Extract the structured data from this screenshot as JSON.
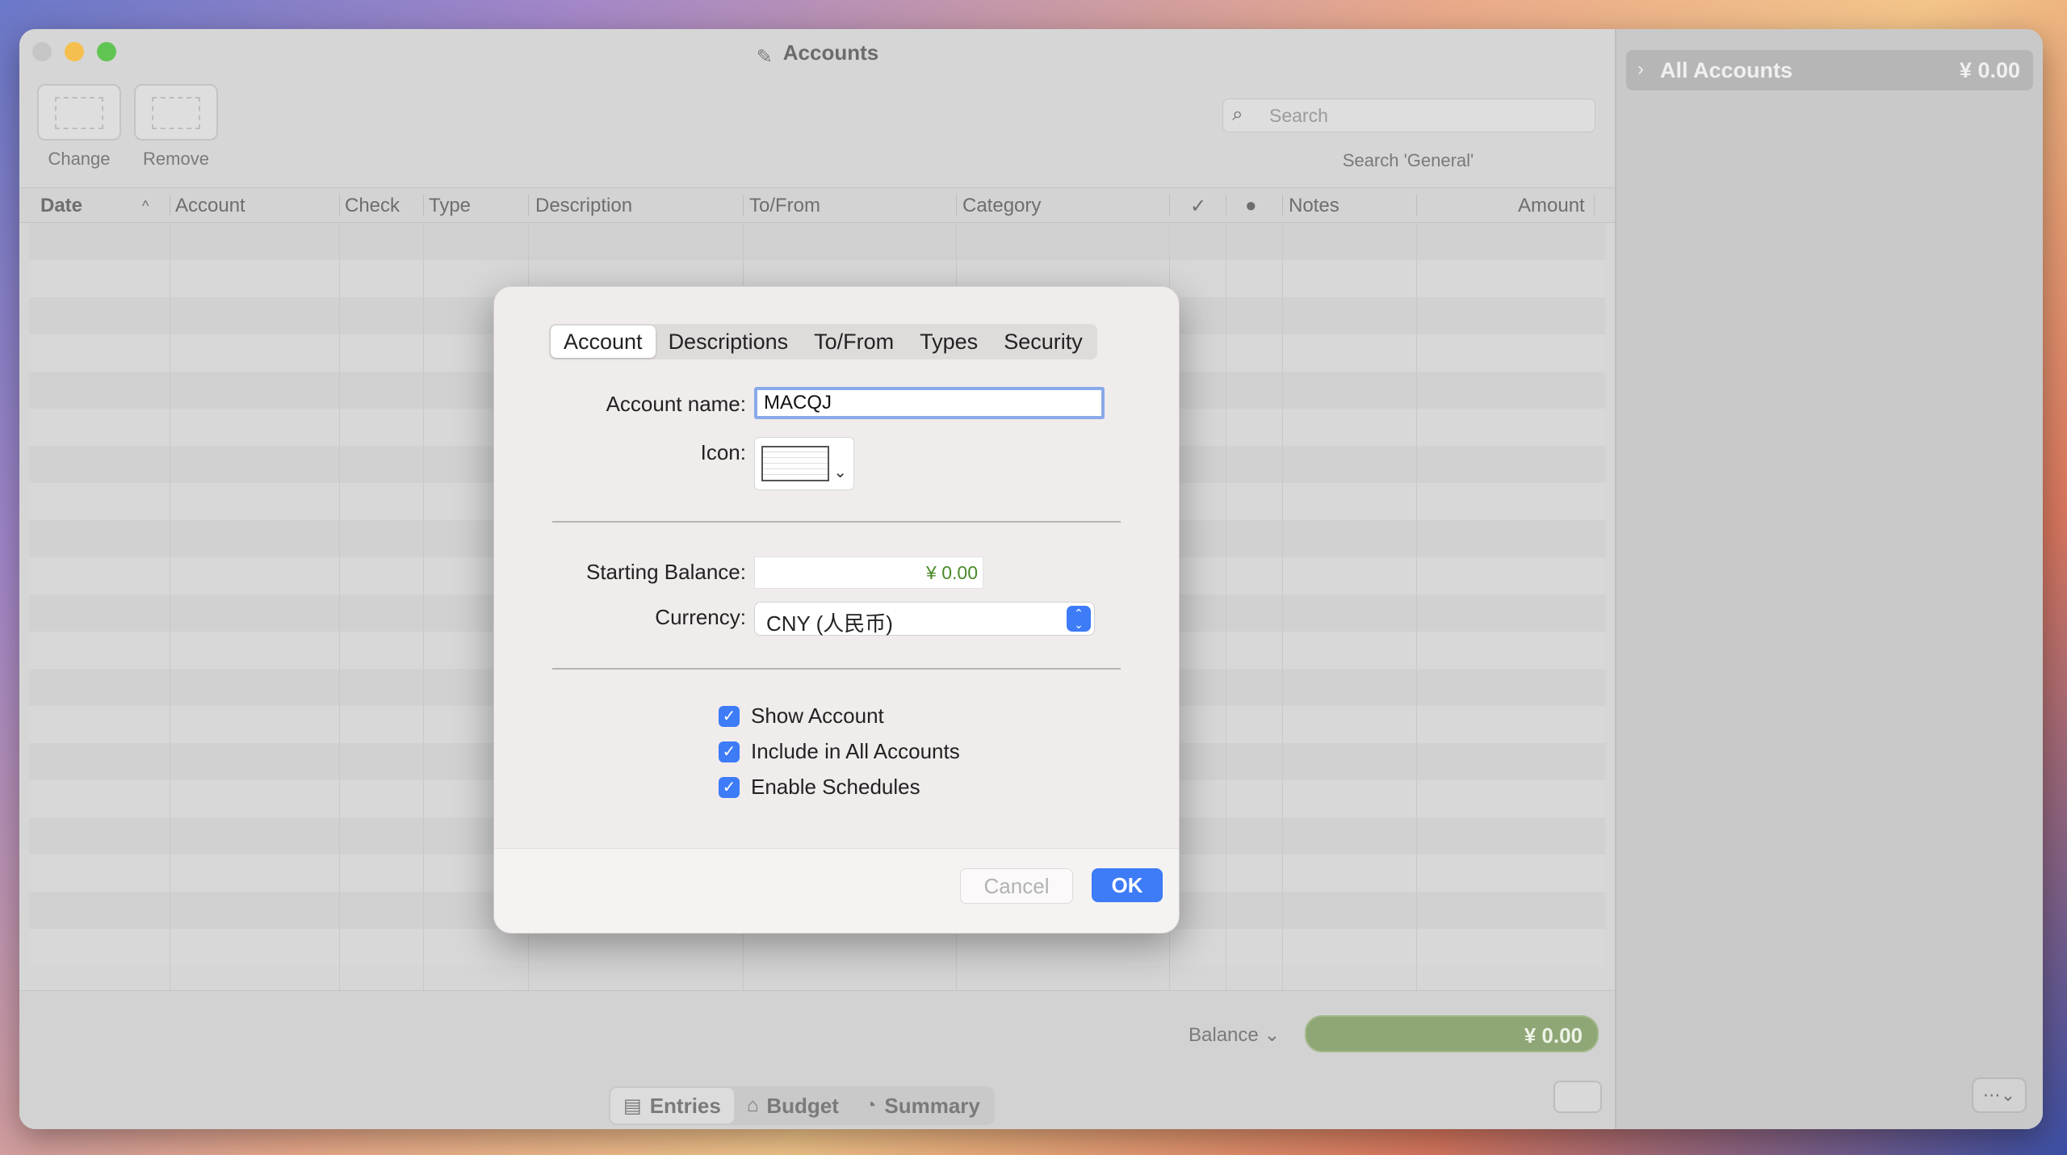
{
  "window": {
    "title": "Accounts"
  },
  "toolbar": {
    "change_label": "Change",
    "remove_label": "Remove"
  },
  "search": {
    "placeholder": "Search",
    "scope": "Search 'General'"
  },
  "table": {
    "columns": [
      "Date",
      "Account",
      "Check",
      "Type",
      "Description",
      "To/From",
      "Category",
      "✓",
      "",
      "Notes",
      "Amount"
    ]
  },
  "footer": {
    "balance_label": "Balance",
    "balance_value": "¥ 0.00",
    "views": [
      "Entries",
      "Budget",
      "Summary"
    ]
  },
  "sidebar": {
    "all_accounts_label": "All Accounts",
    "all_accounts_amount": "¥ 0.00"
  },
  "dialog": {
    "tabs": [
      "Account",
      "Descriptions",
      "To/From",
      "Types",
      "Security"
    ],
    "account_name_label": "Account name:",
    "account_name_value": "MACQJ",
    "icon_label": "Icon:",
    "starting_balance_label": "Starting Balance:",
    "starting_balance_value": "¥ 0.00",
    "currency_label": "Currency:",
    "currency_value": "CNY (人民币)",
    "checkboxes": [
      "Show Account",
      "Include in All Accounts",
      "Enable Schedules"
    ],
    "cancel_label": "Cancel",
    "ok_label": "OK"
  },
  "colors": {
    "accent": "#3d7bf7",
    "balance_green": "#8fa776",
    "amount_green": "#4a8a2a"
  }
}
